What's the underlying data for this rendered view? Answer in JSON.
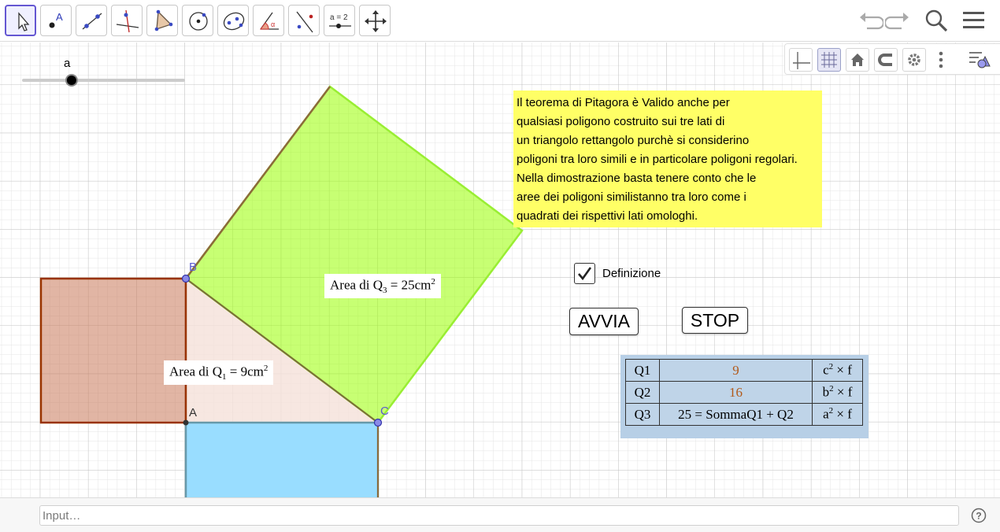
{
  "toolbar": {
    "tools": [
      "move-tool",
      "point-tool",
      "segment-tool",
      "perpendicular-line-tool",
      "polygon-tool",
      "circle-center-point-tool",
      "conic-tool",
      "angle-tool",
      "reflect-tool",
      "slider-tool",
      "move-graphics-view-tool"
    ],
    "slider_tool_text": "a = 2",
    "point_tool_text": "A"
  },
  "style_bar": {
    "buttons": [
      "axes",
      "grid",
      "home",
      "magnet",
      "settings",
      "more",
      "toggle-style"
    ]
  },
  "slider": {
    "label": "a",
    "value_fraction": 0.3
  },
  "note": {
    "lines": [
      "Il teorema di Pitagora è Valido anche per",
      "qualsiasi poligono costruito sui tre lati di",
      "un triangolo rettangolo purchè si considerino",
      "poligoni tra loro simili e in particolare poligoni regolari.",
      "Nella dimostrazione basta tenere conto che le",
      "aree dei poligoni similistanno tra loro come i",
      "quadrati dei rispettivi lati omologhi."
    ],
    "color": "#ffff66"
  },
  "points": {
    "A": "A",
    "B": "B",
    "C": "C"
  },
  "area_labels": {
    "q3": {
      "prefix": "Area di Q",
      "sub": "3",
      "eq": " = 25cm",
      "sup": "2"
    },
    "q1": {
      "prefix": "Area di Q",
      "sub": "1",
      "eq": " = 9cm",
      "sup": "2"
    }
  },
  "checkbox": {
    "label": "Definizione",
    "checked": true
  },
  "buttons": {
    "avvia": "AVVIA",
    "stop": "STOP"
  },
  "table": {
    "rows": [
      {
        "name": "Q1",
        "value": "9",
        "formula_var": "c",
        "formula_sup": "2",
        "formula_rest": " × f",
        "orange": true
      },
      {
        "name": "Q2",
        "value": "16",
        "formula_var": "b",
        "formula_sup": "2",
        "formula_rest": " × f",
        "orange": true
      },
      {
        "name": "Q3",
        "value": "25 = SommaQ1 + Q2",
        "formula_var": "a",
        "formula_sup": "2",
        "formula_rest": " × f",
        "orange": false
      }
    ]
  },
  "input": {
    "placeholder": "Input…"
  },
  "colors": {
    "square_q1": "#c8795a",
    "square_q3": "#99ff00",
    "square_q2": "#99ddff",
    "triangle": "#f5e1d9",
    "accent": "#6557d2"
  }
}
